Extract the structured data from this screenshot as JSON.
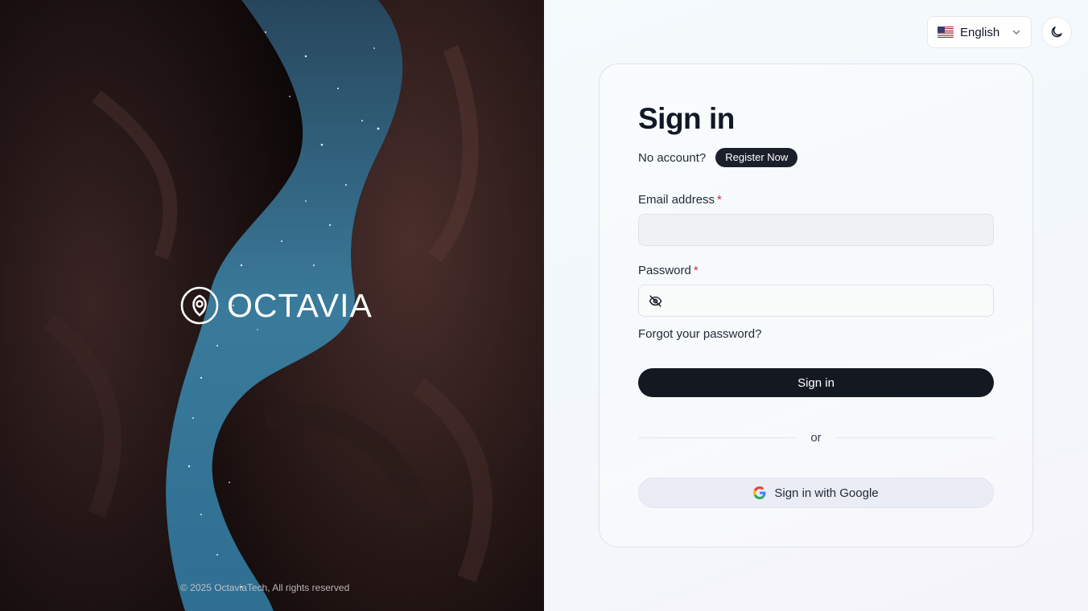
{
  "hero": {
    "brand_name": "OCTAVIA",
    "copyright": "© 2025 OctaviaTech, All rights reserved"
  },
  "header": {
    "language": {
      "selected": "English",
      "flag_icon": "us-flag-icon"
    },
    "theme_toggle_icon": "moon-icon"
  },
  "signin": {
    "title": "Sign in",
    "no_account_text": "No account?",
    "register_label": "Register Now",
    "email_label": "Email address",
    "password_label": "Password",
    "required_mark": "*",
    "forgot_label": "Forgot your password?",
    "submit_label": "Sign in",
    "divider_text": "or",
    "google_label": "Sign in with Google"
  },
  "colors": {
    "primary_button": "#141821",
    "required": "#e11d48"
  }
}
